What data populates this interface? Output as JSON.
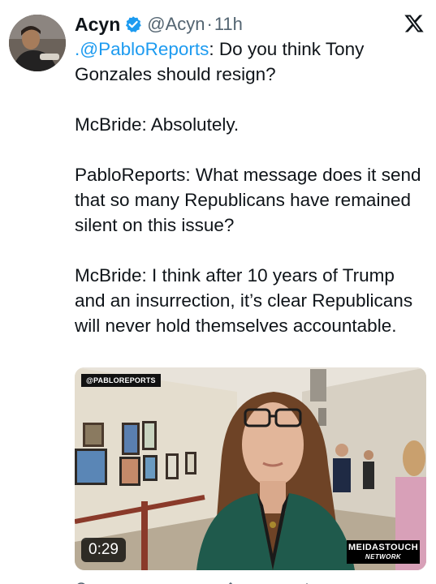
{
  "tweet": {
    "author_name": "Acyn",
    "handle": "@Acyn",
    "separator": "·",
    "time": "11h",
    "mention": ".@PabloReports",
    "line1_rest": ": Do you think Tony Gonzales should resign?",
    "line2": "McBride: Absolutely.",
    "line3": "PabloReports: What message does it send that so many Republicans have remained silent on this issue?",
    "line4": "McBride: I think after 10 years of Trump and an insurrection, it’s clear Republicans will never hold themselves accountable."
  },
  "media": {
    "overlay_tag": "@PABLOREPORTS",
    "duration": "0:29",
    "brand_line1": "MEIDASTOUCH",
    "brand_line2": "NETWORK"
  },
  "colors": {
    "link": "#1d9bf0",
    "verified": "#1d9bf0",
    "secondary_text": "#536471",
    "primary_text": "#0f1419"
  },
  "icons": {
    "verified": "verified-badge-icon",
    "platform": "x-logo-icon"
  }
}
